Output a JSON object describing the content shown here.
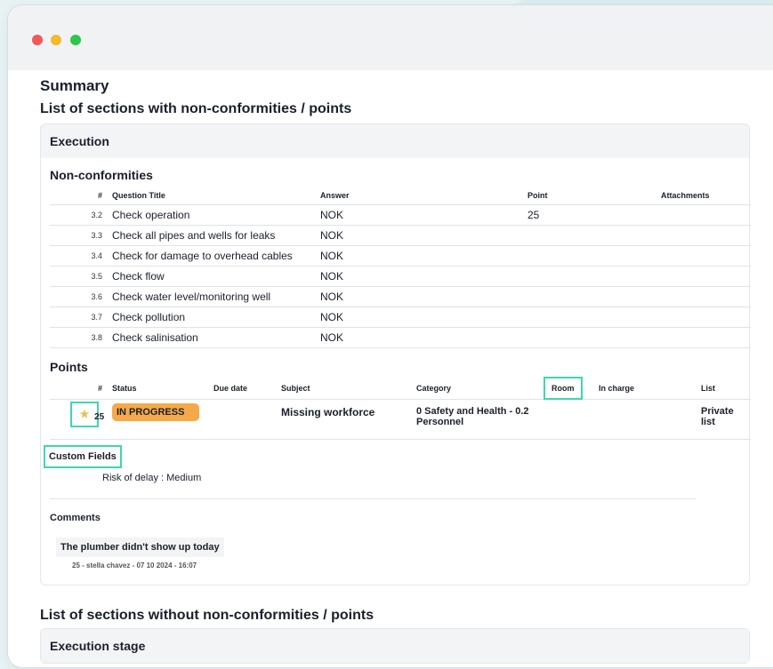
{
  "page": {
    "summary_title": "Summary",
    "with_nc_title": "List of sections with non-conformities / points",
    "without_nc_title": "List of sections without non-conformities / points"
  },
  "execution": {
    "section_title": "Execution",
    "nonconformities_title": "Non-conformities",
    "nc_columns": {
      "num": "#",
      "question": "Question Title",
      "answer": "Answer",
      "point": "Point",
      "attachments": "Attachments"
    },
    "nc_rows": [
      {
        "num": "3.2",
        "question": "Check operation",
        "answer": "NOK",
        "point": "25",
        "attachments": ""
      },
      {
        "num": "3.3",
        "question": "Check all pipes and wells for leaks",
        "answer": "NOK",
        "point": "",
        "attachments": ""
      },
      {
        "num": "3.4",
        "question": "Check for damage to overhead cables",
        "answer": "NOK",
        "point": "",
        "attachments": ""
      },
      {
        "num": "3.5",
        "question": "Check flow",
        "answer": "NOK",
        "point": "",
        "attachments": ""
      },
      {
        "num": "3.6",
        "question": "Check water level/monitoring well",
        "answer": "NOK",
        "point": "",
        "attachments": ""
      },
      {
        "num": "3.7",
        "question": "Check pollution",
        "answer": "NOK",
        "point": "",
        "attachments": ""
      },
      {
        "num": "3.8",
        "question": "Check salinisation",
        "answer": "NOK",
        "point": "",
        "attachments": ""
      }
    ],
    "points_title": "Points",
    "pt_columns": {
      "num": "#",
      "status": "Status",
      "due": "Due date",
      "subject": "Subject",
      "category": "Category",
      "room": "Room",
      "incharge": "In charge",
      "list": "List"
    },
    "point": {
      "num": "25",
      "status": "IN PROGRESS",
      "status_color": "#f5a94a",
      "due": "",
      "subject": "Missing workforce",
      "category_line1": "0 Safety and Health - 0.2",
      "category_line2": "Personnel",
      "room": "",
      "incharge": "",
      "list_line1": "Private",
      "list_line2": "list",
      "star_icon": "star-icon"
    },
    "custom_fields_label": "Custom Fields",
    "custom_field_value": "Risk of delay : Medium",
    "comments_title": "Comments",
    "comment_text": "The plumber didn't show up today",
    "comment_meta": "25 - stella chavez - 07 10 2024 - 16:07"
  },
  "execution_stage": {
    "section_title": "Execution stage"
  },
  "colors": {
    "highlight": "#3fd6b0",
    "badge": "#f5a94a"
  }
}
